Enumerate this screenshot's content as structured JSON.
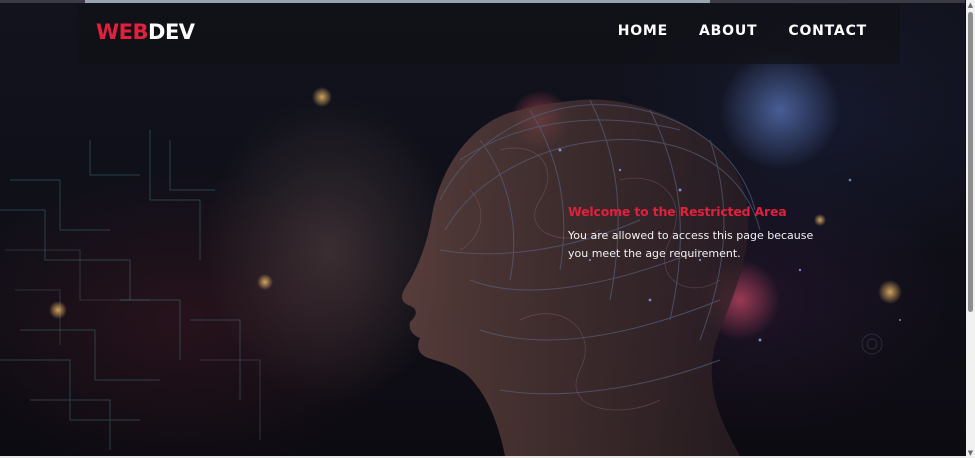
{
  "header": {
    "logo_part1": "WEB",
    "logo_part2": "DEV",
    "nav": [
      {
        "label": "HOME"
      },
      {
        "label": "ABOUT"
      },
      {
        "label": "CONTACT"
      }
    ]
  },
  "main": {
    "title": "Welcome to the Restricted Area",
    "description": "You are allowed to access this page because you meet the age requirement."
  },
  "colors": {
    "accent": "#e0203c",
    "text": "#ffffff",
    "background": "#0f0f18"
  },
  "icons": {
    "scroll_up": "▲",
    "scroll_down": "▼"
  }
}
